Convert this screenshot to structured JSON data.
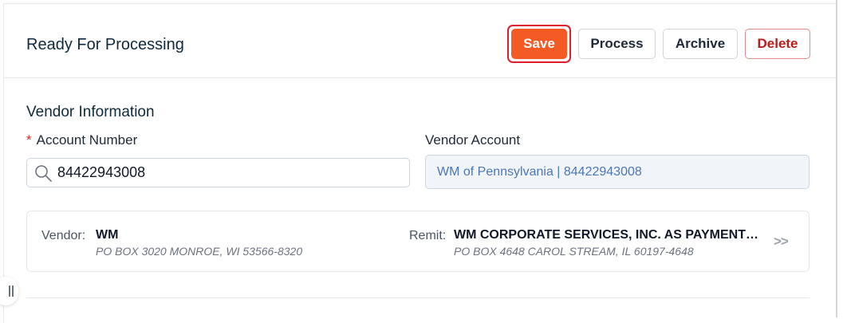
{
  "header": {
    "title": "Ready For Processing",
    "buttons": {
      "save": "Save",
      "process": "Process",
      "archive": "Archive",
      "delete": "Delete"
    }
  },
  "vendor_info": {
    "section_title": "Vendor Information",
    "account_number": {
      "label": "Account Number",
      "required_marker": "*",
      "value": "84422943008"
    },
    "vendor_account": {
      "label": "Vendor Account",
      "value": "WM of Pennsylvania | 84422943008"
    }
  },
  "vendor_card": {
    "vendor_label": "Vendor:",
    "vendor_name": "WM",
    "vendor_address": "PO BOX 3020 MONROE, WI 53566-8320",
    "remit_label": "Remit:",
    "remit_name": "WM CORPORATE SERVICES, INC. AS PAYMENT AGENT",
    "remit_address": "PO BOX 4648 CAROL STREAM, IL 60197-4648",
    "expand_label": ">>"
  },
  "colors": {
    "save_button": "#f45a24",
    "highlight_outline": "#e11d2b",
    "delete_text": "#b91c1c",
    "vendor_account_text": "#4a77b4"
  }
}
